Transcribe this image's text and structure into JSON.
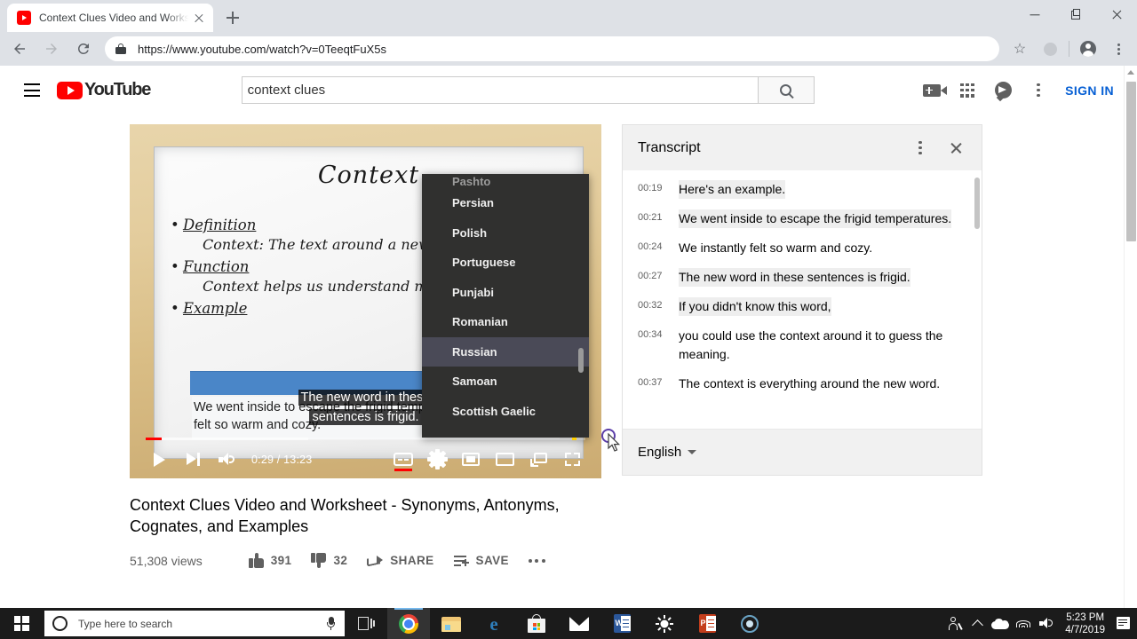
{
  "browser": {
    "tab": {
      "title": "Context Clues Video and Worksh",
      "favicon": "youtube-favicon"
    },
    "newtab_label": "+",
    "url": "https://www.youtube.com/watch?v=0TeeqtFuX5s",
    "window_controls": {
      "minimize": "minimize-icon",
      "maximize": "restore-icon",
      "close": "close-icon"
    },
    "nav": {
      "back": "back-arrow-icon",
      "forward": "forward-arrow-icon",
      "reload": "reload-icon"
    },
    "toolbar_icons": [
      "star-icon",
      "profile-circle-icon",
      "account-icon",
      "chrome-menu-icon"
    ]
  },
  "youtube": {
    "header": {
      "menu_icon": "hamburger-icon",
      "logo_text": "YouTube",
      "search_value": "context clues",
      "search_placeholder": "Search",
      "search_button_icon": "search-icon",
      "create_icon": "video-camera-icon",
      "apps_icon": "apps-grid-icon",
      "messages_icon": "messages-icon",
      "more_icon": "more-vertical-icon",
      "sign_in_label": "SIGN IN"
    },
    "player": {
      "whiteboard": {
        "title": "Context",
        "items": [
          {
            "heading": "Definition",
            "detail": "Context: The text around a new word"
          },
          {
            "heading": "Function",
            "detail": "Context helps us understand meaning."
          },
          {
            "heading": "Example",
            "detail": ""
          }
        ],
        "example_sentences": "We went inside to escape the frigid temperatures. We instantly felt so warm and cozy."
      },
      "caption_text": "The new word in these sentences is frigid.",
      "time_current": "0:29",
      "time_total": "13:23",
      "time_display": "0:29 / 13:23",
      "progress_percent": 3.6,
      "buffered_percent": 37,
      "chapter_marker_percent": 97,
      "controls": {
        "play": "play-icon",
        "next": "next-video-icon",
        "volume": "volume-icon",
        "captions": "closed-captions-icon",
        "settings": "settings-gear-icon",
        "miniplayer": "miniplayer-icon",
        "theater": "theater-mode-icon",
        "cast": "cast-icon",
        "fullscreen": "fullscreen-icon"
      },
      "language_menu": {
        "selected": "Russian",
        "items": [
          "Pashto",
          "Persian",
          "Polish",
          "Portuguese",
          "Punjabi",
          "Romanian",
          "Russian",
          "Samoan",
          "Scottish Gaelic"
        ]
      }
    },
    "video_info": {
      "title": "Context Clues Video and Worksheet - Synonyms, Antonyms, Cognates, and Examples",
      "views": "51,308 views",
      "like_count": "391",
      "dislike_count": "32",
      "share_label": "SHARE",
      "save_label": "SAVE",
      "more_label": "more-actions-icon"
    },
    "transcript": {
      "title": "Transcript",
      "menu_icon": "more-vertical-icon",
      "close_icon": "close-icon",
      "language": "English",
      "rows": [
        {
          "time": "00:19",
          "text": "Here's an example.",
          "highlighted": false
        },
        {
          "time": "00:21",
          "text": "We went inside to escape the frigid temperatures.",
          "highlighted": true
        },
        {
          "time": "00:24",
          "text": "We instantly felt so warm and cozy.",
          "highlighted": false
        },
        {
          "time": "00:27",
          "text": "The new word in these sentences is frigid.",
          "highlighted": true
        },
        {
          "time": "00:32",
          "text": "If you didn't know this word,",
          "highlighted": true
        },
        {
          "time": "00:34",
          "text": "you could use the context around it to guess the meaning.",
          "highlighted": false
        },
        {
          "time": "00:37",
          "text": "The context is everything around the new word.",
          "highlighted": false
        }
      ]
    }
  },
  "taskbar": {
    "start_icon": "windows-start-icon",
    "search_placeholder": "Type here to search",
    "cortana_icon": "cortana-circle-icon",
    "mic_icon": "microphone-icon",
    "apps": [
      {
        "name": "task-view-icon",
        "active": false
      },
      {
        "name": "chrome-icon",
        "active": true
      },
      {
        "name": "file-explorer-icon",
        "active": false
      },
      {
        "name": "edge-icon",
        "active": false
      },
      {
        "name": "microsoft-store-icon",
        "active": false
      },
      {
        "name": "mail-icon",
        "active": false
      },
      {
        "name": "word-icon",
        "active": false
      },
      {
        "name": "brightness-icon",
        "active": false
      },
      {
        "name": "powerpoint-icon",
        "active": false
      },
      {
        "name": "screen-recorder-icon",
        "active": false
      }
    ],
    "tray": [
      "people-icon",
      "show-hidden-icons-icon",
      "onedrive-icon",
      "wifi-icon",
      "volume-icon"
    ],
    "time": "5:23 PM",
    "date": "4/7/2019",
    "notifications_icon": "action-center-icon"
  }
}
